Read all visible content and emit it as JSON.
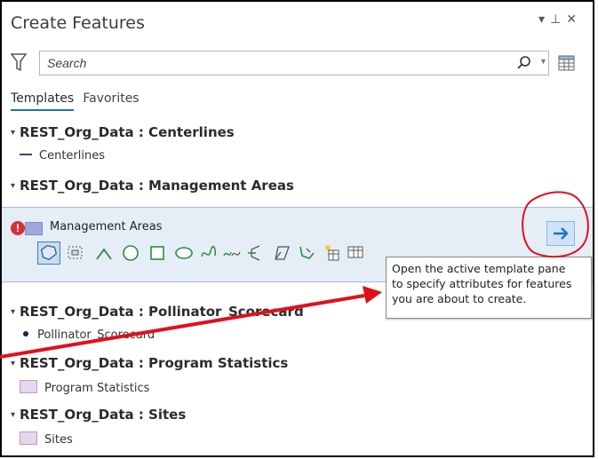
{
  "pane": {
    "title": "Create Features",
    "controls": {
      "pin": "▾ ꟷ",
      "close": "×"
    }
  },
  "search": {
    "placeholder": "Search"
  },
  "tabs": [
    {
      "label": "Templates",
      "active": true
    },
    {
      "label": "Favorites",
      "active": false
    }
  ],
  "groups": [
    {
      "label": "REST_Org_Data : Centerlines",
      "items": [
        {
          "label": "Centerlines",
          "symbol": "line"
        }
      ]
    },
    {
      "label": "REST_Org_Data : Management Areas",
      "items": [
        {
          "label": "Management Areas",
          "symbol": "polygon-selected"
        }
      ]
    },
    {
      "label": "REST_Org_Data : Pollinator_Scorecard",
      "items": [
        {
          "label": "Pollinator_Scorecard",
          "symbol": "point"
        }
      ]
    },
    {
      "label": "REST_Org_Data : Program Statistics",
      "items": [
        {
          "label": "Program Statistics",
          "symbol": "polygon"
        }
      ]
    },
    {
      "label": "REST_Org_Data : Sites",
      "items": [
        {
          "label": "Sites",
          "symbol": "polygon"
        }
      ]
    }
  ],
  "active_template": {
    "label": "Management Areas",
    "warning_icon": "!",
    "tools": [
      "polygon-tool",
      "rectangle-select-tool",
      "arc-tool",
      "circle-tool",
      "rectangle-tool",
      "ellipse-tool",
      "freehand-tool",
      "trace-tool",
      "split-tool",
      "right-angle-tool",
      "stream-tool",
      "autocomplete-tool",
      "table-tool"
    ]
  },
  "tooltip": {
    "line1": "Open the active template pane",
    "line2": "to specify attributes for features",
    "line3": "you are about to create."
  },
  "colors": {
    "accent": "#1a73c7",
    "annotation": "#e0101a",
    "selected_bg": "#e5eef7"
  }
}
